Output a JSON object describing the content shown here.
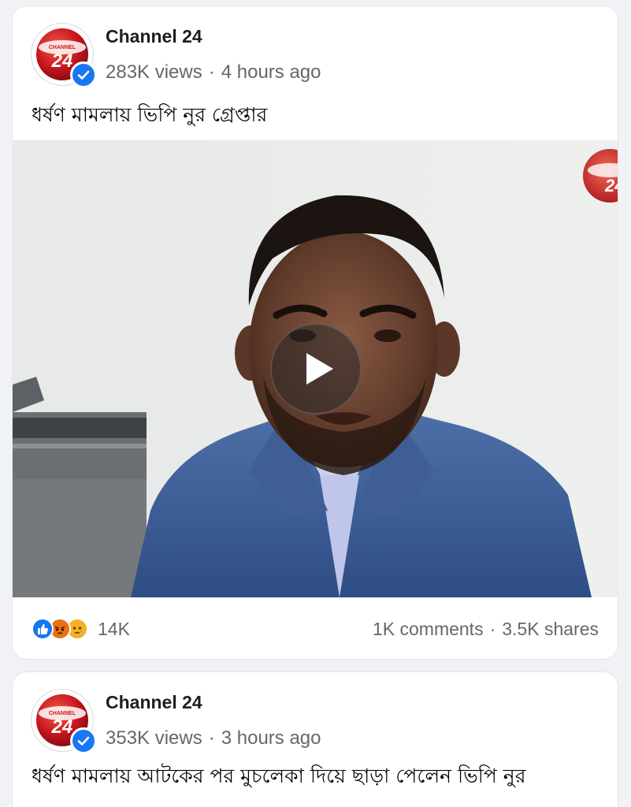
{
  "colors": {
    "background": "#f0f2f5",
    "card": "#ffffff",
    "verified": "#1877f2",
    "secondary_text": "#65676b",
    "brand_red": "#c8161d"
  },
  "posts": [
    {
      "avatar": {
        "icon": "channel-24-logo",
        "logo_text": "24",
        "logo_subtext": "CHANNEL"
      },
      "verified_icon": "verified-check-icon",
      "page_name": "Channel 24",
      "views": "283K views",
      "separator": "·",
      "time": "4 hours ago",
      "caption": "ধর্ষণ মামলায় ভিপি নুর গ্রেপ্তার",
      "media": {
        "type": "video",
        "thumbnail_icon": "video-thumbnail-man-in-blue-blazer",
        "play_icon": "play-icon",
        "watermark_icon": "channel-24-watermark",
        "watermark_text": "24"
      },
      "reactions": {
        "icons": [
          "like-reaction-icon",
          "angry-reaction-icon",
          "sad-reaction-icon"
        ],
        "count": "14K"
      },
      "comments": "1K comments",
      "shares": "3.5K shares"
    },
    {
      "avatar": {
        "icon": "channel-24-logo",
        "logo_text": "24",
        "logo_subtext": "CHANNEL"
      },
      "verified_icon": "verified-check-icon",
      "page_name": "Channel 24",
      "views": "353K views",
      "separator": "·",
      "time": "3 hours ago",
      "caption": "ধর্ষণ মামলায় আটকের পর মুচলেকা দিয়ে ছাড়া পেলেন ভিপি নুর"
    }
  ]
}
